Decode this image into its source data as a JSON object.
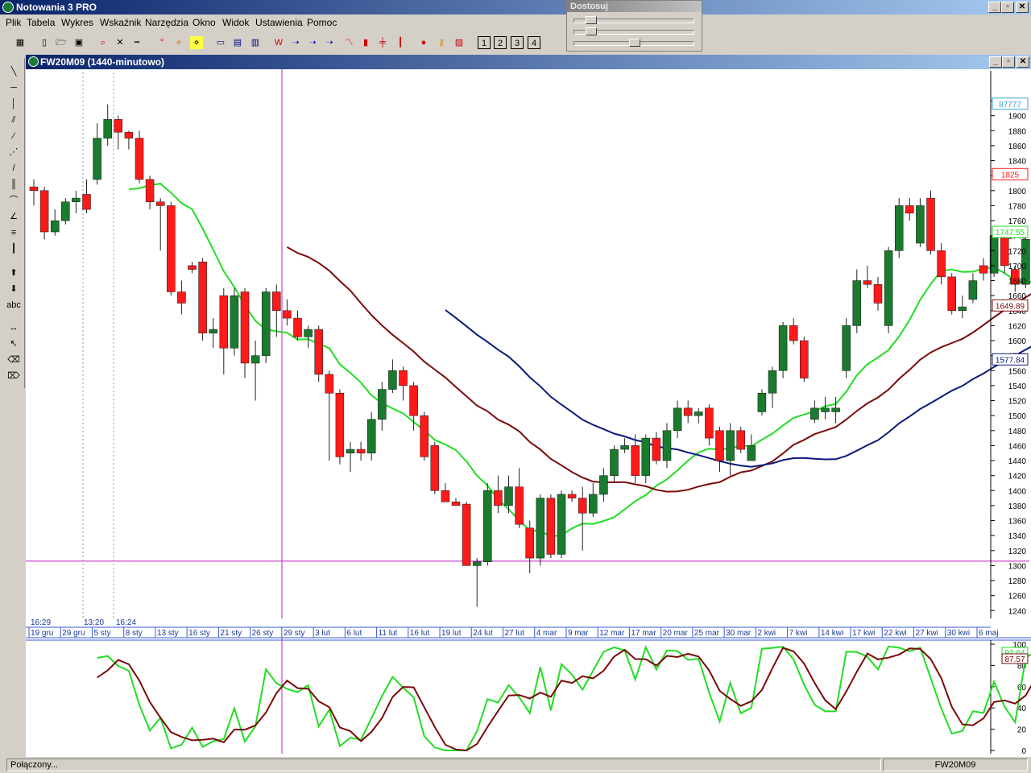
{
  "app": {
    "title": "Notowania 3 PRO"
  },
  "menu": [
    "Plik",
    "Tabela",
    "Wykres",
    "Wskaźnik",
    "Narzędzia",
    "Okno",
    "Widok",
    "Ustawienia",
    "Pomoc"
  ],
  "toolbar": {
    "period_buttons": [
      "1",
      "2",
      "3",
      "4"
    ]
  },
  "dostosuj": {
    "title": "Dostosuj",
    "slider_levels": [
      0.1,
      0.1,
      0.5
    ]
  },
  "chart_window": {
    "title": "FW20M09 (1440-minutowo)"
  },
  "status": {
    "left": "Połączony...",
    "right": "FW20M09"
  },
  "colors": {
    "up": "#1a7a2e",
    "down": "#ff1a1a",
    "green_ma": "#22dd22",
    "brown_ma": "#7a0a0a",
    "navy_ma": "#0a1a7a",
    "light_blue": "#3aa0d8",
    "magenta": "#c020c0"
  },
  "chart_data": {
    "type": "candlestick",
    "y_ticks": [
      1920,
      1900,
      1880,
      1860,
      1840,
      1820,
      1800,
      1780,
      1760,
      1740,
      1720,
      1700,
      1680,
      1660,
      1640,
      1620,
      1600,
      1580,
      1560,
      1540,
      1520,
      1500,
      1480,
      1460,
      1440,
      1420,
      1400,
      1380,
      1360,
      1340,
      1320,
      1300,
      1280,
      1260,
      1240
    ],
    "ylim": [
      1236,
      1934
    ],
    "price_labels": [
      {
        "text": "87777",
        "color": "#3aa0d8",
        "value": 1916
      },
      {
        "text": "1825",
        "color": "#ff1a1a",
        "value": 1822
      },
      {
        "text": "1747.55",
        "color": "#22dd22",
        "value": 1745
      },
      {
        "text": "1649.89",
        "color": "#7a0a0a",
        "value": 1647
      },
      {
        "text": "1577.84",
        "color": "#0a1a7a",
        "value": 1575
      }
    ],
    "time_labels": [
      "16:29",
      "13:20",
      "16:24"
    ],
    "date_labels": [
      "19 gru",
      "29 gru",
      "5 sty",
      "8 sty",
      "13 sty",
      "16 sty",
      "21 sty",
      "26 sty",
      "29 sty",
      "3 lut",
      "6 lut",
      "11 lut",
      "16 lut",
      "19 lut",
      "24 lut",
      "27 lut",
      "4 mar",
      "9 mar",
      "12 mar",
      "17 mar",
      "20 mar",
      "25 mar",
      "30 mar",
      "2 kwi",
      "7 kwi",
      "14 kwi",
      "17 kwi",
      "22 kwi",
      "27 kwi",
      "30 kwi",
      "6 maj"
    ],
    "crosshair_price": 1306,
    "candles": [
      [
        1805,
        1800,
        1815,
        1780
      ],
      [
        1800,
        1745,
        1805,
        1735
      ],
      [
        1745,
        1760,
        1775,
        1740
      ],
      [
        1760,
        1785,
        1790,
        1755
      ],
      [
        1785,
        1790,
        1800,
        1770
      ],
      [
        1795,
        1775,
        1815,
        1770
      ],
      [
        1815,
        1870,
        1890,
        1808
      ],
      [
        1870,
        1895,
        1915,
        1860
      ],
      [
        1895,
        1878,
        1900,
        1855
      ],
      [
        1878,
        1870,
        1880,
        1855
      ],
      [
        1870,
        1815,
        1880,
        1810
      ],
      [
        1815,
        1785,
        1820,
        1775
      ],
      [
        1785,
        1780,
        1790,
        1720
      ],
      [
        1780,
        1665,
        1785,
        1660
      ],
      [
        1665,
        1650,
        1680,
        1635
      ],
      [
        1700,
        1695,
        1705,
        1690
      ],
      [
        1705,
        1610,
        1710,
        1600
      ],
      [
        1610,
        1615,
        1630,
        1590
      ],
      [
        1660,
        1590,
        1670,
        1555
      ],
      [
        1590,
        1660,
        1670,
        1580
      ],
      [
        1665,
        1570,
        1670,
        1550
      ],
      [
        1570,
        1580,
        1600,
        1520
      ],
      [
        1580,
        1665,
        1670,
        1570
      ],
      [
        1665,
        1640,
        1675,
        1605
      ],
      [
        1640,
        1630,
        1655,
        1620
      ],
      [
        1630,
        1605,
        1640,
        1600
      ],
      [
        1605,
        1615,
        1620,
        1590
      ],
      [
        1615,
        1555,
        1620,
        1545
      ],
      [
        1555,
        1530,
        1560,
        1440
      ],
      [
        1530,
        1445,
        1535,
        1435
      ],
      [
        1450,
        1455,
        1465,
        1425
      ],
      [
        1455,
        1450,
        1465,
        1440
      ],
      [
        1450,
        1495,
        1505,
        1440
      ],
      [
        1495,
        1535,
        1545,
        1480
      ],
      [
        1535,
        1560,
        1575,
        1530
      ],
      [
        1560,
        1540,
        1565,
        1520
      ],
      [
        1540,
        1500,
        1545,
        1480
      ],
      [
        1500,
        1445,
        1505,
        1440
      ],
      [
        1460,
        1400,
        1465,
        1395
      ],
      [
        1400,
        1385,
        1410,
        1385
      ],
      [
        1385,
        1380,
        1390,
        1380
      ],
      [
        1382,
        1300,
        1385,
        1300
      ],
      [
        1300,
        1305,
        1310,
        1245
      ],
      [
        1305,
        1400,
        1410,
        1300
      ],
      [
        1400,
        1380,
        1420,
        1370
      ],
      [
        1380,
        1405,
        1420,
        1370
      ],
      [
        1405,
        1355,
        1430,
        1350
      ],
      [
        1350,
        1310,
        1360,
        1290
      ],
      [
        1310,
        1390,
        1395,
        1300
      ],
      [
        1390,
        1315,
        1395,
        1310
      ],
      [
        1315,
        1395,
        1400,
        1310
      ],
      [
        1395,
        1390,
        1400,
        1385
      ],
      [
        1390,
        1370,
        1405,
        1320
      ],
      [
        1370,
        1395,
        1410,
        1365
      ],
      [
        1395,
        1420,
        1430,
        1385
      ],
      [
        1420,
        1455,
        1460,
        1410
      ],
      [
        1455,
        1460,
        1470,
        1450
      ],
      [
        1460,
        1420,
        1475,
        1410
      ],
      [
        1420,
        1470,
        1475,
        1410
      ],
      [
        1470,
        1440,
        1478,
        1435
      ],
      [
        1440,
        1480,
        1490,
        1430
      ],
      [
        1480,
        1510,
        1520,
        1470
      ],
      [
        1510,
        1500,
        1520,
        1490
      ],
      [
        1500,
        1505,
        1510,
        1490
      ],
      [
        1510,
        1470,
        1515,
        1460
      ],
      [
        1480,
        1440,
        1485,
        1425
      ],
      [
        1440,
        1480,
        1490,
        1420
      ],
      [
        1480,
        1455,
        1485,
        1450
      ],
      [
        1440,
        1460,
        1475,
        1440
      ],
      [
        1505,
        1530,
        1535,
        1500
      ],
      [
        1530,
        1560,
        1565,
        1510
      ],
      [
        1560,
        1620,
        1625,
        1550
      ],
      [
        1620,
        1600,
        1630,
        1595
      ],
      [
        1600,
        1550,
        1605,
        1545
      ],
      [
        1495,
        1510,
        1520,
        1490
      ],
      [
        1505,
        1510,
        1525,
        1495
      ],
      [
        1505,
        1510,
        1525,
        1490
      ],
      [
        1560,
        1620,
        1630,
        1550
      ],
      [
        1620,
        1680,
        1695,
        1610
      ],
      [
        1680,
        1675,
        1700,
        1670
      ],
      [
        1675,
        1650,
        1685,
        1640
      ],
      [
        1620,
        1720,
        1725,
        1610
      ],
      [
        1720,
        1780,
        1790,
        1710
      ],
      [
        1780,
        1770,
        1790,
        1760
      ],
      [
        1730,
        1780,
        1790,
        1725
      ],
      [
        1790,
        1720,
        1800,
        1715
      ],
      [
        1720,
        1685,
        1730,
        1675
      ],
      [
        1685,
        1640,
        1690,
        1635
      ],
      [
        1640,
        1645,
        1660,
        1630
      ],
      [
        1655,
        1680,
        1690,
        1650
      ],
      [
        1700,
        1690,
        1710,
        1680
      ],
      [
        1690,
        1740,
        1750,
        1685
      ],
      [
        1740,
        1700,
        1745,
        1690
      ],
      [
        1695,
        1675,
        1700,
        1665
      ],
      [
        1675,
        1735,
        1750,
        1670
      ],
      [
        1745,
        1765,
        1775,
        1740
      ],
      [
        1805,
        1855,
        1875,
        1800
      ],
      [
        1870,
        1832,
        1880,
        1830
      ],
      [
        1822,
        1825,
        1865,
        1820
      ]
    ],
    "stoch_ylim": [
      0,
      100
    ],
    "stoch_ticks": [
      100,
      80,
      60,
      40,
      20,
      0
    ],
    "stoch_labels": [
      {
        "text": "92.64",
        "color": "#22dd22"
      },
      {
        "text": "87.57",
        "color": "#7a0a0a"
      }
    ]
  }
}
